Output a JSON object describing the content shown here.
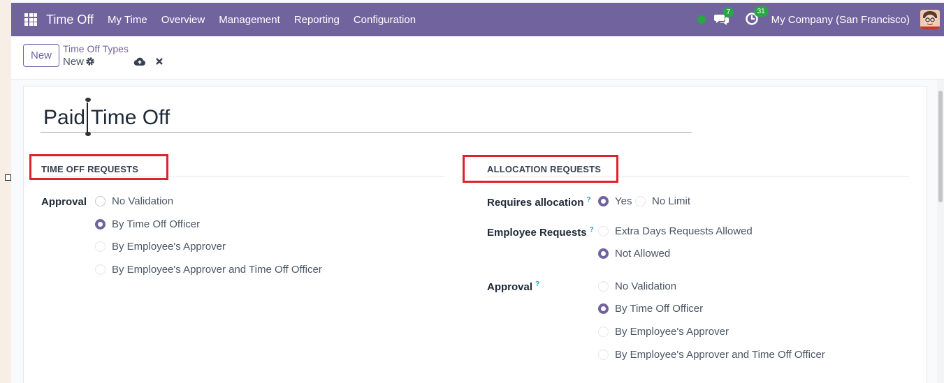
{
  "navbar": {
    "brand": "Time Off",
    "menu": [
      "My Time",
      "Overview",
      "Management",
      "Reporting",
      "Configuration"
    ],
    "messages_count": "7",
    "activities_count": "31",
    "company": "My Company (San Francisco)",
    "accent_color": "#71639e"
  },
  "control": {
    "new_label": "New",
    "breadcrumb_parent": "Time Off Types",
    "breadcrumb_current": "New"
  },
  "form": {
    "title_value": "Paid Time Off",
    "time_off_section": "TIME OFF REQUESTS",
    "allocation_section": "ALLOCATION REQUESTS",
    "approval_label": "Approval",
    "approval_options": [
      "No Validation",
      "By Time Off Officer",
      "By Employee's Approver",
      "By Employee's Approver and Time Off Officer"
    ],
    "requires_allocation_label": "Requires allocation",
    "requires_allocation_options": [
      "Yes",
      "No Limit"
    ],
    "employee_requests_label": "Employee Requests",
    "employee_requests_options": [
      "Extra Days Requests Allowed",
      "Not Allowed"
    ],
    "allocation_approval_label": "Approval",
    "allocation_approval_options": [
      "No Validation",
      "By Time Off Officer",
      "By Employee's Approver",
      "By Employee's Approver and Time Off Officer"
    ],
    "help_mark": "?"
  }
}
